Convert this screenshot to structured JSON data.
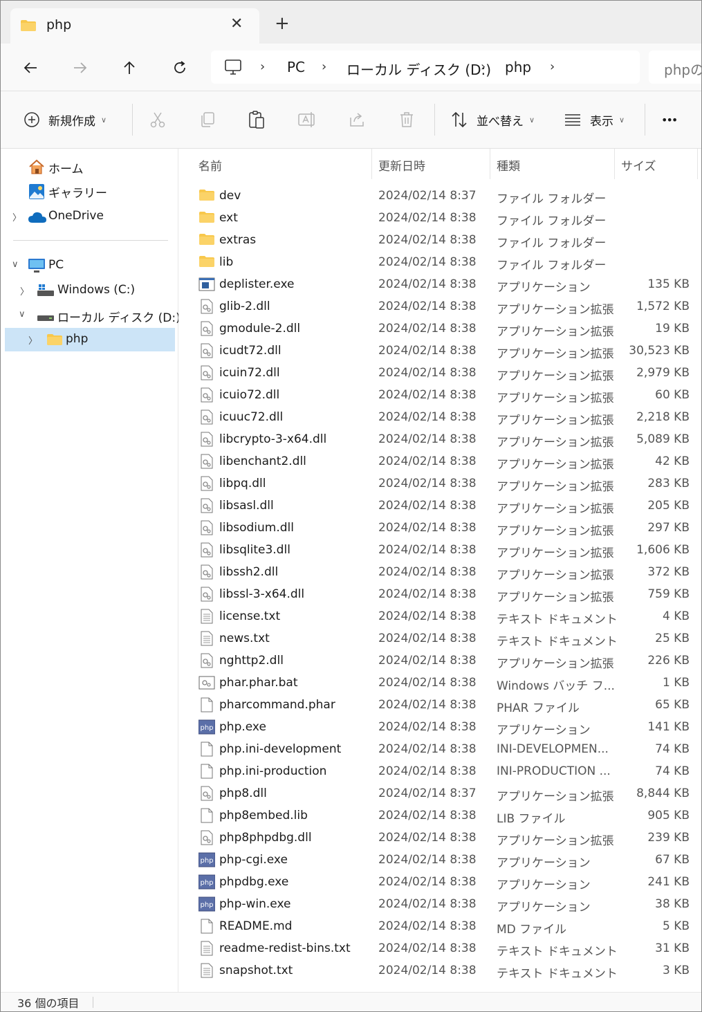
{
  "window": {
    "tab_title": "php",
    "close_glyph": "✕",
    "add_glyph": "+"
  },
  "address": {
    "crumbs": [
      "PC",
      "ローカル ディスク (D:)",
      "php"
    ],
    "search_placeholder": "phpの検索"
  },
  "toolbar": {
    "new_label": "新規作成",
    "sort_label": "並べ替え",
    "view_label": "表示",
    "more_glyph": "•••"
  },
  "sidebar": {
    "home": "ホーム",
    "gallery": "ギャラリー",
    "onedrive": "OneDrive",
    "pc": "PC",
    "windows_c": "Windows (C:)",
    "local_d": "ローカル ディスク (D:)",
    "php": "php"
  },
  "columns": {
    "name": "名前",
    "date": "更新日時",
    "type": "種類",
    "size": "サイズ"
  },
  "files": [
    {
      "name": "dev",
      "date": "2024/02/14 8:37",
      "type": "ファイル フォルダー",
      "size": "",
      "icon": "folder"
    },
    {
      "name": "ext",
      "date": "2024/02/14 8:38",
      "type": "ファイル フォルダー",
      "size": "",
      "icon": "folder"
    },
    {
      "name": "extras",
      "date": "2024/02/14 8:38",
      "type": "ファイル フォルダー",
      "size": "",
      "icon": "folder"
    },
    {
      "name": "lib",
      "date": "2024/02/14 8:38",
      "type": "ファイル フォルダー",
      "size": "",
      "icon": "folder"
    },
    {
      "name": "deplister.exe",
      "date": "2024/02/14 8:38",
      "type": "アプリケーション",
      "size": "135 KB",
      "icon": "exe"
    },
    {
      "name": "glib-2.dll",
      "date": "2024/02/14 8:38",
      "type": "アプリケーション拡張",
      "size": "1,572 KB",
      "icon": "dll"
    },
    {
      "name": "gmodule-2.dll",
      "date": "2024/02/14 8:38",
      "type": "アプリケーション拡張",
      "size": "19 KB",
      "icon": "dll"
    },
    {
      "name": "icudt72.dll",
      "date": "2024/02/14 8:38",
      "type": "アプリケーション拡張",
      "size": "30,523 KB",
      "icon": "dll"
    },
    {
      "name": "icuin72.dll",
      "date": "2024/02/14 8:38",
      "type": "アプリケーション拡張",
      "size": "2,979 KB",
      "icon": "dll"
    },
    {
      "name": "icuio72.dll",
      "date": "2024/02/14 8:38",
      "type": "アプリケーション拡張",
      "size": "60 KB",
      "icon": "dll"
    },
    {
      "name": "icuuc72.dll",
      "date": "2024/02/14 8:38",
      "type": "アプリケーション拡張",
      "size": "2,218 KB",
      "icon": "dll"
    },
    {
      "name": "libcrypto-3-x64.dll",
      "date": "2024/02/14 8:38",
      "type": "アプリケーション拡張",
      "size": "5,089 KB",
      "icon": "dll"
    },
    {
      "name": "libenchant2.dll",
      "date": "2024/02/14 8:38",
      "type": "アプリケーション拡張",
      "size": "42 KB",
      "icon": "dll"
    },
    {
      "name": "libpq.dll",
      "date": "2024/02/14 8:38",
      "type": "アプリケーション拡張",
      "size": "283 KB",
      "icon": "dll"
    },
    {
      "name": "libsasl.dll",
      "date": "2024/02/14 8:38",
      "type": "アプリケーション拡張",
      "size": "205 KB",
      "icon": "dll"
    },
    {
      "name": "libsodium.dll",
      "date": "2024/02/14 8:38",
      "type": "アプリケーション拡張",
      "size": "297 KB",
      "icon": "dll"
    },
    {
      "name": "libsqlite3.dll",
      "date": "2024/02/14 8:38",
      "type": "アプリケーション拡張",
      "size": "1,606 KB",
      "icon": "dll"
    },
    {
      "name": "libssh2.dll",
      "date": "2024/02/14 8:38",
      "type": "アプリケーション拡張",
      "size": "372 KB",
      "icon": "dll"
    },
    {
      "name": "libssl-3-x64.dll",
      "date": "2024/02/14 8:38",
      "type": "アプリケーション拡張",
      "size": "759 KB",
      "icon": "dll"
    },
    {
      "name": "license.txt",
      "date": "2024/02/14 8:38",
      "type": "テキスト ドキュメント",
      "size": "4 KB",
      "icon": "txt"
    },
    {
      "name": "news.txt",
      "date": "2024/02/14 8:38",
      "type": "テキスト ドキュメント",
      "size": "25 KB",
      "icon": "txt"
    },
    {
      "name": "nghttp2.dll",
      "date": "2024/02/14 8:38",
      "type": "アプリケーション拡張",
      "size": "226 KB",
      "icon": "dll"
    },
    {
      "name": "phar.phar.bat",
      "date": "2024/02/14 8:38",
      "type": "Windows バッチ フ...",
      "size": "1 KB",
      "icon": "bat"
    },
    {
      "name": "pharcommand.phar",
      "date": "2024/02/14 8:38",
      "type": "PHAR ファイル",
      "size": "65 KB",
      "icon": "blank"
    },
    {
      "name": "php.exe",
      "date": "2024/02/14 8:38",
      "type": "アプリケーション",
      "size": "141 KB",
      "icon": "php"
    },
    {
      "name": "php.ini-development",
      "date": "2024/02/14 8:38",
      "type": "INI-DEVELOPMEN...",
      "size": "74 KB",
      "icon": "blank"
    },
    {
      "name": "php.ini-production",
      "date": "2024/02/14 8:38",
      "type": "INI-PRODUCTION ...",
      "size": "74 KB",
      "icon": "blank"
    },
    {
      "name": "php8.dll",
      "date": "2024/02/14 8:37",
      "type": "アプリケーション拡張",
      "size": "8,844 KB",
      "icon": "dll"
    },
    {
      "name": "php8embed.lib",
      "date": "2024/02/14 8:38",
      "type": "LIB ファイル",
      "size": "905 KB",
      "icon": "blank"
    },
    {
      "name": "php8phpdbg.dll",
      "date": "2024/02/14 8:38",
      "type": "アプリケーション拡張",
      "size": "239 KB",
      "icon": "dll"
    },
    {
      "name": "php-cgi.exe",
      "date": "2024/02/14 8:38",
      "type": "アプリケーション",
      "size": "67 KB",
      "icon": "php"
    },
    {
      "name": "phpdbg.exe",
      "date": "2024/02/14 8:38",
      "type": "アプリケーション",
      "size": "241 KB",
      "icon": "php"
    },
    {
      "name": "php-win.exe",
      "date": "2024/02/14 8:38",
      "type": "アプリケーション",
      "size": "38 KB",
      "icon": "php"
    },
    {
      "name": "README.md",
      "date": "2024/02/14 8:38",
      "type": "MD ファイル",
      "size": "5 KB",
      "icon": "blank"
    },
    {
      "name": "readme-redist-bins.txt",
      "date": "2024/02/14 8:38",
      "type": "テキスト ドキュメント",
      "size": "31 KB",
      "icon": "txt"
    },
    {
      "name": "snapshot.txt",
      "date": "2024/02/14 8:38",
      "type": "テキスト ドキュメント",
      "size": "3 KB",
      "icon": "txt"
    }
  ],
  "status": {
    "item_count": "36 個の項目"
  },
  "colors": {
    "selection": "#cce4f7",
    "folder": "#f8c84c",
    "accent": "#0067c0"
  }
}
